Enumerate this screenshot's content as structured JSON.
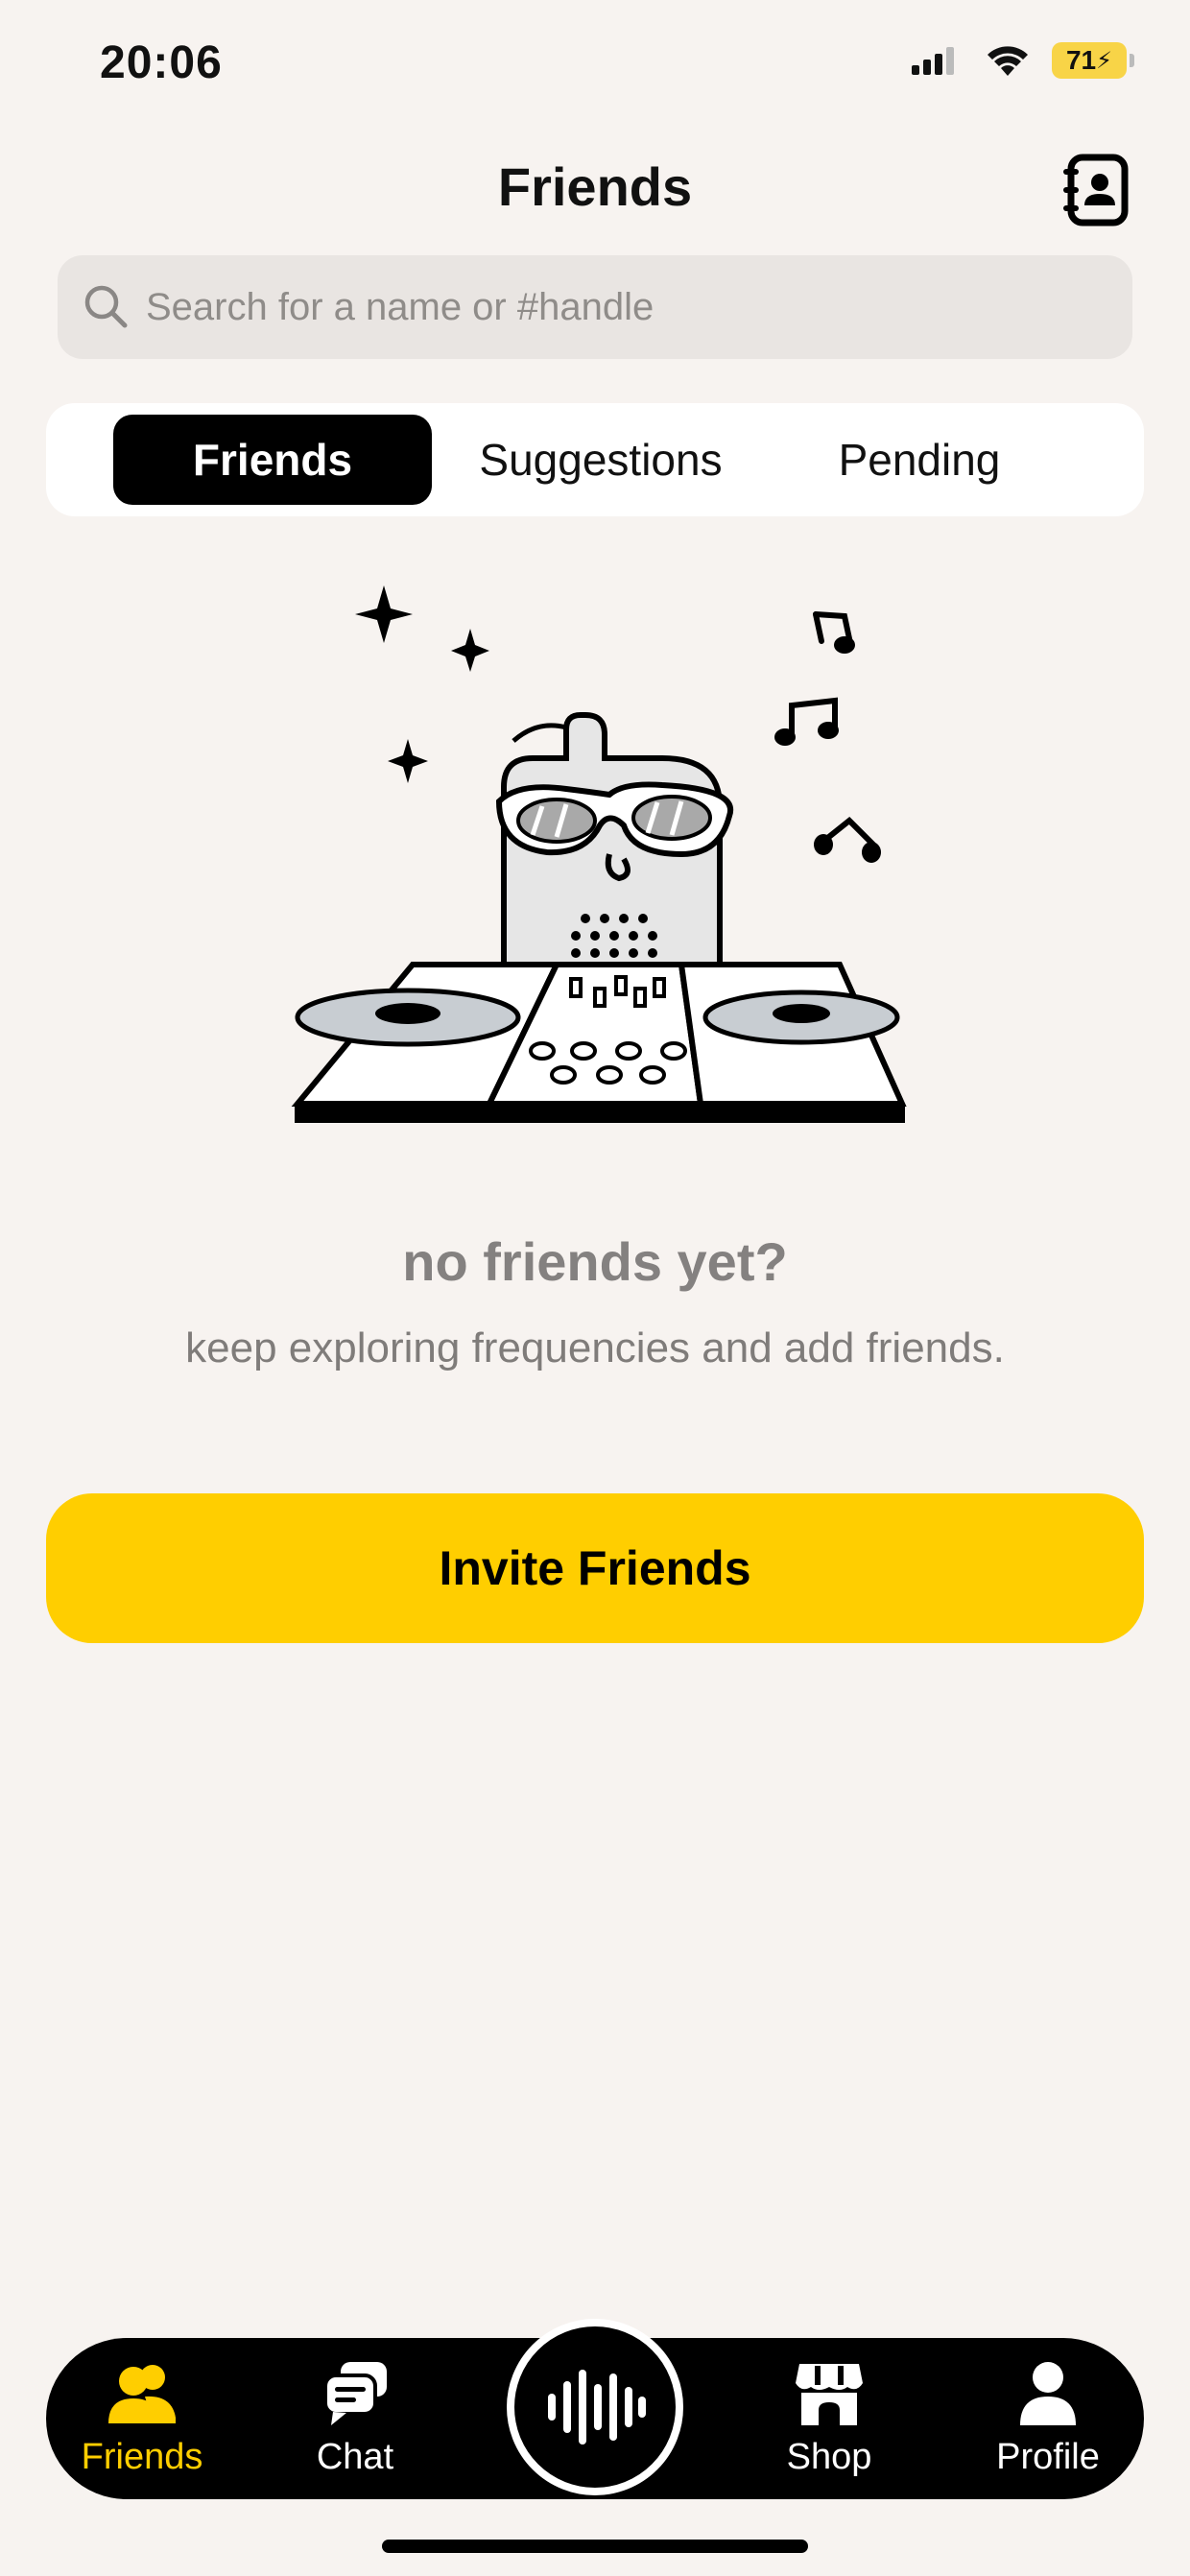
{
  "status_bar": {
    "time": "20:06",
    "battery": "71"
  },
  "header": {
    "title": "Friends",
    "contacts_icon": "contacts-book-icon"
  },
  "search": {
    "placeholder": "Search for a name or #handle"
  },
  "tabs": [
    {
      "label": "Friends",
      "active": true
    },
    {
      "label": "Suggestions",
      "active": false
    },
    {
      "label": "Pending",
      "active": false
    }
  ],
  "empty_state": {
    "title": "no friends yet?",
    "subtitle": "keep exploring frequencies and add friends.",
    "illustration": "dj-robot-illustration"
  },
  "invite_button": {
    "label": "Invite Friends"
  },
  "nav": [
    {
      "label": "Friends",
      "icon": "people-icon",
      "active": true
    },
    {
      "label": "Chat",
      "icon": "chat-bubbles-icon",
      "active": false
    },
    {
      "label": "",
      "icon": "waveform-icon",
      "active": false
    },
    {
      "label": "Shop",
      "icon": "shop-icon",
      "active": false
    },
    {
      "label": "Profile",
      "icon": "person-icon",
      "active": false
    }
  ],
  "colors": {
    "accent": "#FFCE00",
    "background": "#F7F3F0",
    "muted_text": "#848180"
  }
}
